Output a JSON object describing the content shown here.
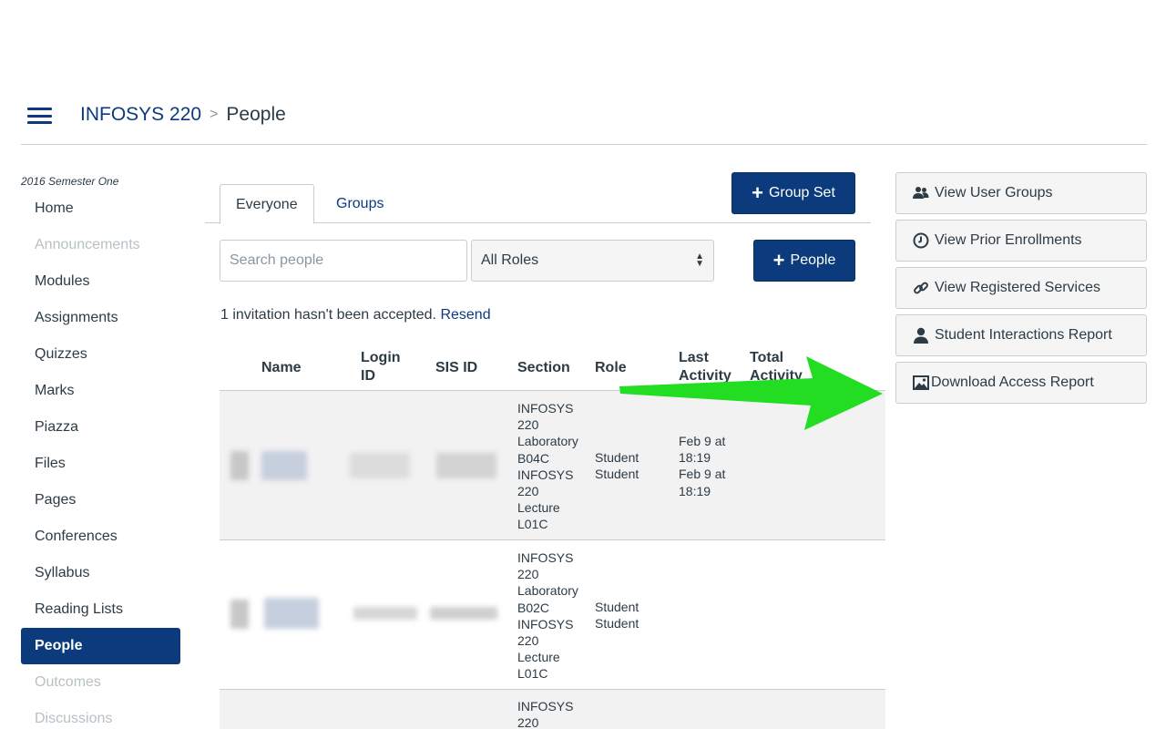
{
  "breadcrumb": {
    "course": "INFOSYS 220",
    "separator": ">",
    "current": "People"
  },
  "sidebar": {
    "term": "2016 Semester One",
    "items": [
      {
        "label": "Home",
        "state": "normal"
      },
      {
        "label": "Announcements",
        "state": "disabled"
      },
      {
        "label": "Modules",
        "state": "normal"
      },
      {
        "label": "Assignments",
        "state": "normal"
      },
      {
        "label": "Quizzes",
        "state": "normal"
      },
      {
        "label": "Marks",
        "state": "normal"
      },
      {
        "label": "Piazza",
        "state": "normal"
      },
      {
        "label": "Files",
        "state": "normal"
      },
      {
        "label": "Pages",
        "state": "normal"
      },
      {
        "label": "Conferences",
        "state": "normal"
      },
      {
        "label": "Syllabus",
        "state": "normal"
      },
      {
        "label": "Reading Lists",
        "state": "normal"
      },
      {
        "label": "People",
        "state": "active"
      },
      {
        "label": "Outcomes",
        "state": "disabled"
      },
      {
        "label": "Discussions",
        "state": "disabled"
      }
    ]
  },
  "tabs": [
    {
      "label": "Everyone",
      "active": true
    },
    {
      "label": "Groups",
      "active": false
    }
  ],
  "buttons": {
    "group_set": "Group Set",
    "add_people": "People"
  },
  "search": {
    "placeholder": "Search people",
    "value": ""
  },
  "role_filter": {
    "selected": "All Roles"
  },
  "invitation": {
    "message": "1 invitation hasn't been accepted.",
    "resend": "Resend"
  },
  "table": {
    "headers": {
      "name": "Name",
      "login_id": "Login ID",
      "sis_id": "SIS ID",
      "section": "Section",
      "role": "Role",
      "last_activity": "Last Activity",
      "total_activity": "Total Activity"
    },
    "rows": [
      {
        "section": "INFOSYS 220 Laboratory B04C INFOSYS 220 Lecture L01C",
        "role": "Student Student",
        "last_activity": "Feb 9 at 18:19 Feb 9 at 18:19"
      },
      {
        "section": "INFOSYS 220 Laboratory B02C INFOSYS 220 Lecture L01C",
        "role": "Student Student",
        "last_activity": ""
      },
      {
        "section": "INFOSYS 220",
        "role": "",
        "last_activity": ""
      }
    ]
  },
  "side_actions": [
    {
      "label": "View User Groups",
      "icon": "users-icon"
    },
    {
      "label": "View Prior Enrollments",
      "icon": "clock-icon"
    },
    {
      "label": "View Registered Services",
      "icon": "link-icon"
    },
    {
      "label": "Student Interactions Report",
      "icon": "user-icon"
    },
    {
      "label": "Download Access Report",
      "icon": "image-icon"
    }
  ],
  "colors": {
    "brand": "#0b3b7d",
    "annotation_arrow": "#22dd22"
  }
}
